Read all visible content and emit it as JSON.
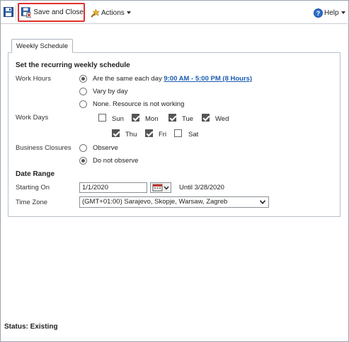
{
  "toolbar": {
    "save_close_label": "Save and Close",
    "actions_label": "Actions",
    "help_label": "Help"
  },
  "tabs": [
    {
      "label": "Weekly Schedule"
    }
  ],
  "section": {
    "title": "Set the recurring weekly schedule"
  },
  "work_hours": {
    "label": "Work Hours",
    "options": [
      {
        "label": "Are the same each day",
        "selected": true
      },
      {
        "label": "Vary by day",
        "selected": false
      },
      {
        "label": "None. Resource is not working",
        "selected": false
      }
    ],
    "hours_link": "9:00 AM - 5:00 PM (8 Hours)"
  },
  "work_days": {
    "label": "Work Days",
    "days": [
      {
        "label": "Sun",
        "checked": false
      },
      {
        "label": "Mon",
        "checked": true
      },
      {
        "label": "Tue",
        "checked": true
      },
      {
        "label": "Wed",
        "checked": true
      },
      {
        "label": "Thu",
        "checked": true
      },
      {
        "label": "Fri",
        "checked": true
      },
      {
        "label": "Sat",
        "checked": false
      }
    ]
  },
  "business_closures": {
    "label": "Business Closures",
    "options": [
      {
        "label": "Observe",
        "selected": false
      },
      {
        "label": "Do not observe",
        "selected": true
      }
    ]
  },
  "date_range": {
    "title": "Date Range",
    "starting_on_label": "Starting On",
    "starting_on_value": "1/1/2020",
    "until_text": "Until 3/28/2020",
    "time_zone_label": "Time Zone",
    "time_zone_value": "(GMT+01:00) Sarajevo, Skopje, Warsaw, Zagreb"
  },
  "status": {
    "text": "Status: Existing"
  },
  "colors": {
    "accent_border": "#e0312e",
    "link": "#1a5bb0"
  }
}
